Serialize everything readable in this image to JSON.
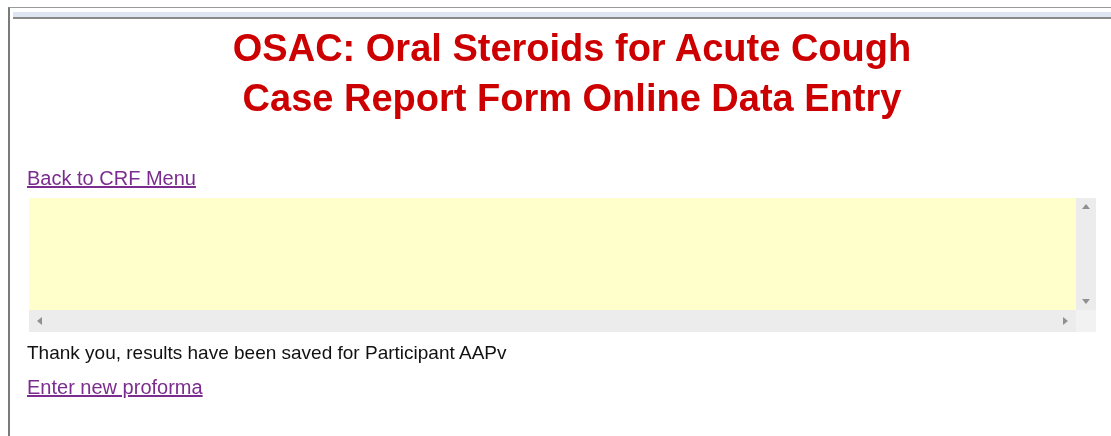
{
  "title_lines": [
    "OSAC: Oral Steroids for Acute Cough",
    "Case Report Form Online Data Entry"
  ],
  "back_link": "Back to CRF Menu",
  "message": "Thank you, results have been saved for Participant AAPv",
  "new_link": "Enter new proforma"
}
